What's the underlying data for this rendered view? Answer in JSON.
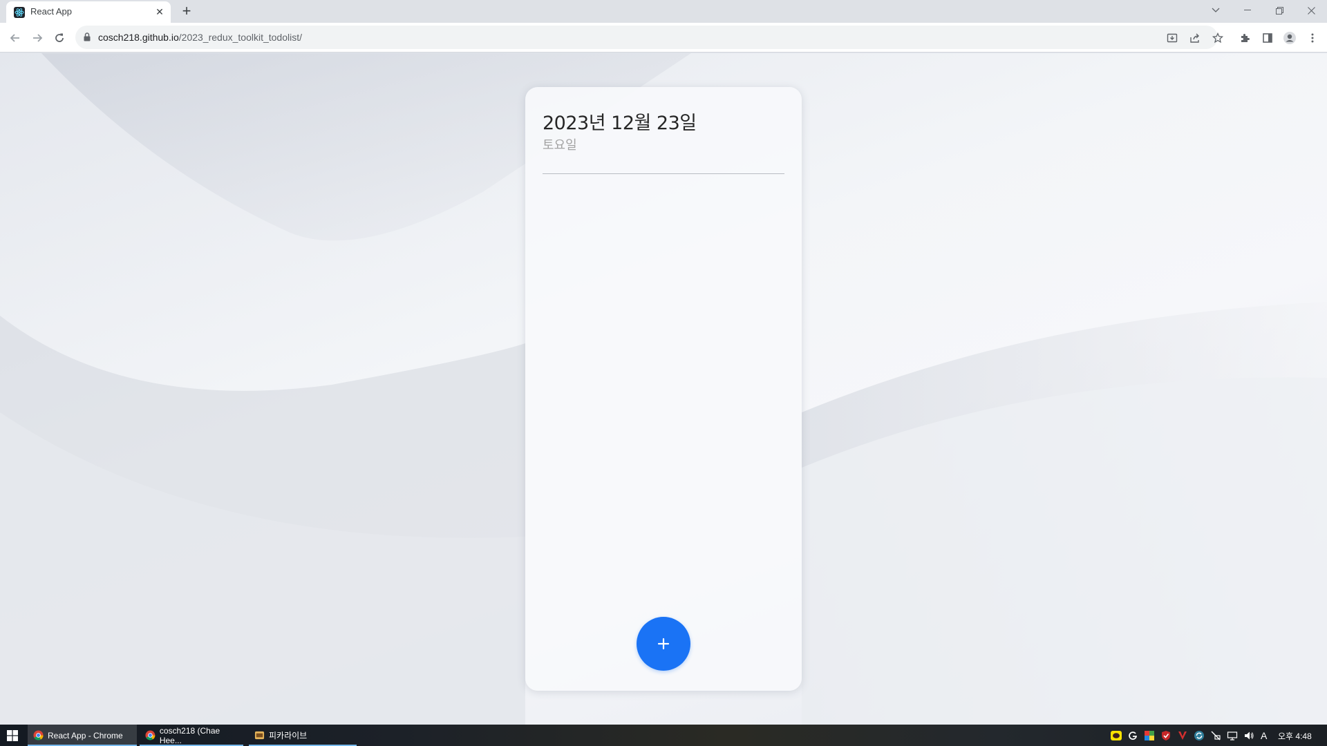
{
  "browser": {
    "tab_title": "React App",
    "url_host": "cosch218.github.io",
    "url_path": "/2023_redux_toolkit_todolist/"
  },
  "app": {
    "date": "2023년 12월 23일",
    "weekday": "토요일",
    "todos": [],
    "add_button_icon": "plus-icon",
    "accent_color": "#1a73f5"
  },
  "taskbar": {
    "items": [
      {
        "label": "React App - Chrome",
        "icon": "chrome-icon"
      },
      {
        "label": "cosch218 (Chae Hee...",
        "icon": "chrome-icon"
      },
      {
        "label": "피카라이브",
        "icon": "app-icon"
      }
    ],
    "clock": "오후 4:48",
    "ime": "A"
  }
}
